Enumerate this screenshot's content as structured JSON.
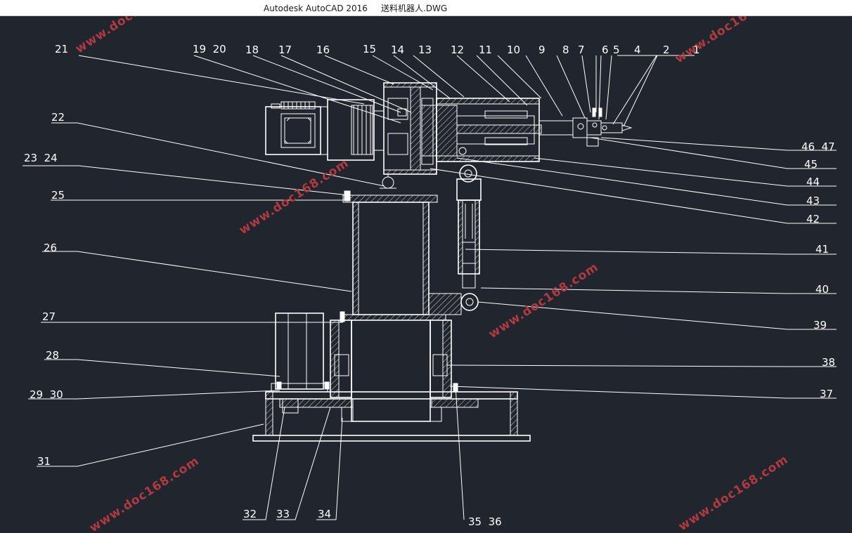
{
  "window": {
    "title": "Autodesk AutoCAD 2016     送料机器人.DWG"
  },
  "watermark": {
    "text": "www.doc168.com",
    "color": "#b03a40"
  },
  "drawing": {
    "background": "#21252d",
    "line_color": "#ffffff"
  },
  "labels": {
    "l1": "1",
    "l2": "2",
    "l4": "4",
    "l5": "5",
    "l6": "6",
    "l7": "7",
    "l8": "8",
    "l9": "9",
    "l10": "10",
    "l11": "11",
    "l12": "12",
    "l13": "13",
    "l14": "14",
    "l15": "15",
    "l16": "16",
    "l17": "17",
    "l18": "18",
    "l19_20": "19  20",
    "l21": "21",
    "l22": "22",
    "l23_24": "23  24",
    "l25": "25",
    "l26": "26",
    "l27": "27",
    "l28": "28",
    "l29_30": "29  30",
    "l31": "31",
    "l32": "32",
    "l33": "33",
    "l34": "34",
    "l35_36": "35  36",
    "l37": "37",
    "l38": "38",
    "l39": "39",
    "l40": "40",
    "l41": "41",
    "l42": "42",
    "l43": "43",
    "l44": "44",
    "l45": "45",
    "l46_47": "46  47"
  }
}
